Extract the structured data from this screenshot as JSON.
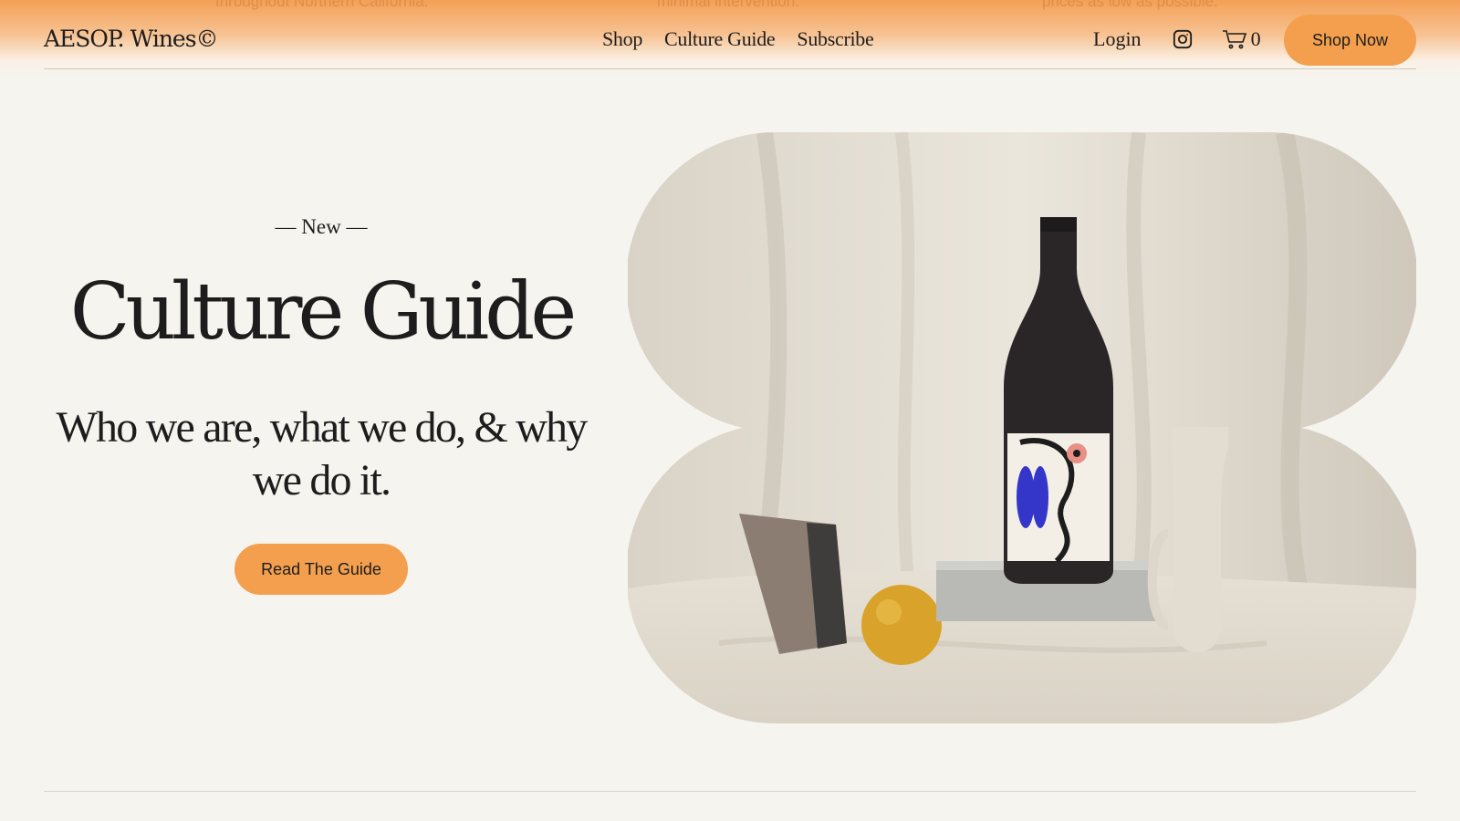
{
  "ticker": {
    "items": [
      "throughout Northern California.",
      "minimal intervention.",
      "prices as low as possible."
    ]
  },
  "header": {
    "logo": "AESOP. Wines©",
    "nav": [
      "Shop",
      "Culture Guide",
      "Subscribe"
    ],
    "login": "Login",
    "instagram_icon": "instagram-icon",
    "cart_icon": "cart-icon",
    "cart_count": "0",
    "cta": "Shop Now"
  },
  "hero": {
    "eyebrow": "— New —",
    "title": "Culture Guide",
    "subtitle": "Who we are, what we do, & why we do it.",
    "button": "Read The Guide"
  },
  "colors": {
    "accent": "#f39f4e",
    "background": "#f6f4ef",
    "text": "#1d1d1d"
  }
}
